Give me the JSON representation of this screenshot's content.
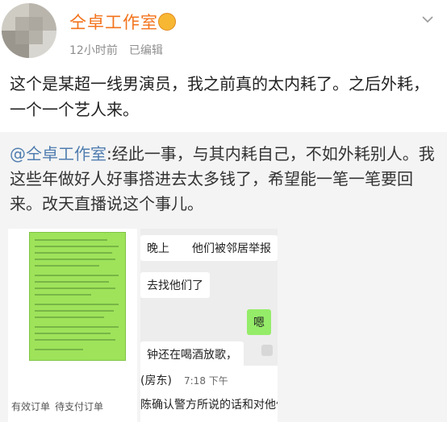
{
  "author": {
    "name": "仝卓工作室",
    "time": "12小时前",
    "edited": "已编辑"
  },
  "post": {
    "text": "这个是某超一线男演员，我之前真的太内耗了。之后外耗，一个一个艺人来。"
  },
  "repost": {
    "mention": "@仝卓工作室",
    "text": ":经此一事，与其内耗自己，不如外耗别人。我这些年做好人好事搭进去太多钱了，希望能一笔一笔要回来。改天直播说这个事儿。"
  },
  "image_left": {
    "tab1": "有效订单",
    "tab2": "待支付订单"
  },
  "image_right": {
    "bubble1": "晚上　　他们被邻居举报",
    "bubble2": "去找他们了",
    "bubble3": "嗯",
    "bubble4": "钟还在喝酒放歌，",
    "contact_name": "(房东)",
    "contact_time": "7:18 下午",
    "contact_msg": "陈确认警方所说的话和对他们"
  },
  "colors": {
    "username": "#f2731c",
    "mention": "#507daf",
    "repost_bg": "#f4f4f4",
    "chat_green": "#95ec69",
    "doc_green": "#9ee35a"
  },
  "icons": {
    "vip": "vip-badge-icon",
    "more": "chevron-down-icon"
  }
}
